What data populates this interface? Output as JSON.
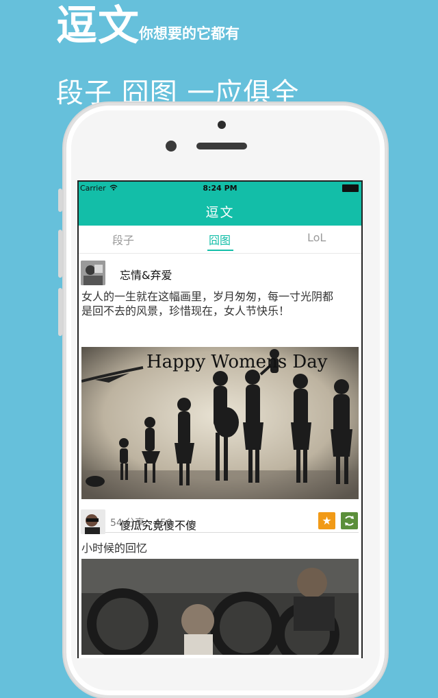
{
  "promo": {
    "title": "逗文",
    "subtitle": "你想要的它都有",
    "line2": "段子 囧图 一应俱全"
  },
  "status_bar": {
    "carrier": "Carrier",
    "time": "8:24 PM"
  },
  "navbar": {
    "title": "逗文"
  },
  "tabs": [
    {
      "label": "段子",
      "active": false
    },
    {
      "label": "囧图",
      "active": true
    },
    {
      "label": "LoL",
      "active": false
    }
  ],
  "posts": [
    {
      "username": "忘情&弃爱",
      "text_line1": "女人的一生就在这幅画里，岁月匆匆，每一寸光阴都",
      "text_line2": "是回不去的风景，珍惜现在，女人节快乐！",
      "image_caption": "Happy Womens Day",
      "stats": "评论：54  分享：450"
    },
    {
      "username": "傻瓜究竟傻不傻",
      "text_line1": "小时候的回忆"
    }
  ],
  "icons": {
    "favorite": "star-icon",
    "share": "refresh-icon"
  },
  "colors": {
    "background": "#66c0db",
    "accent": "#13bea8",
    "favorite": "#f19a17",
    "share": "#5b8f3a"
  }
}
